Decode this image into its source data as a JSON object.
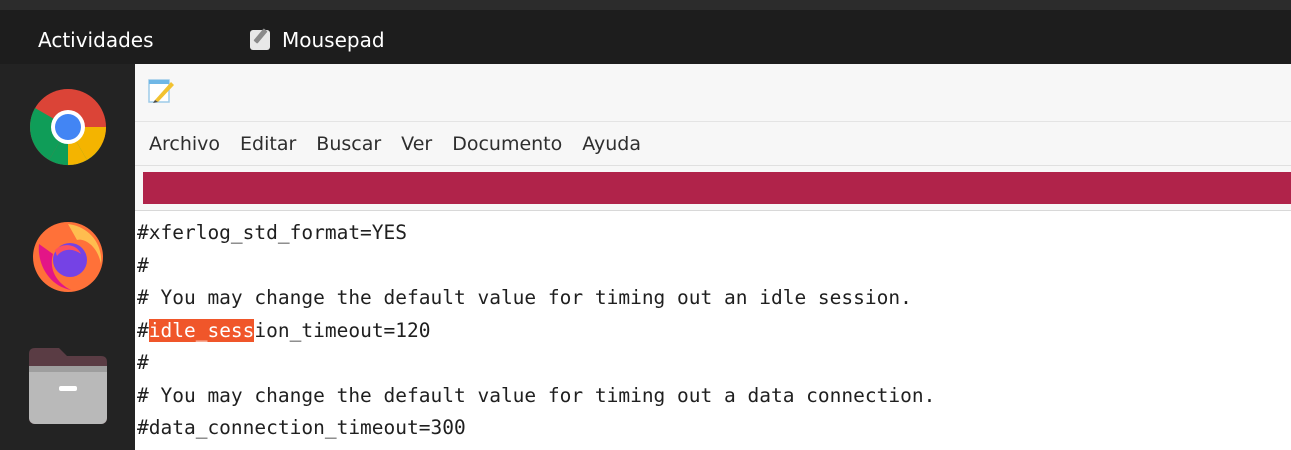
{
  "topbar": {
    "activities_label": "Actividades",
    "app_name": "Mousepad",
    "app_icon": "mousepad-icon",
    "background": "#1d1d1d"
  },
  "dock": {
    "items": [
      {
        "name": "Google Chrome",
        "icon": "chrome-icon"
      },
      {
        "name": "Firefox",
        "icon": "firefox-icon"
      },
      {
        "name": "Files",
        "icon": "folder-icon"
      }
    ]
  },
  "window": {
    "title_icon": "notepad-icon",
    "menu": [
      "Archivo",
      "Editar",
      "Buscar",
      "Ver",
      "Documento",
      "Ayuda"
    ],
    "search_bar_color": "#b0234a"
  },
  "editor": {
    "lines": [
      "#xferlog_std_format=YES",
      "#",
      "# You may change the default value for timing out an idle session.",
      "#idle_session_timeout=120",
      "#",
      "# You may change the default value for timing out a data connection.",
      "#data_connection_timeout=300"
    ],
    "highlight": {
      "line": 3,
      "before": "#",
      "match": "idle_sess",
      "after": "ion_timeout=120",
      "color": "#f0562a"
    }
  }
}
